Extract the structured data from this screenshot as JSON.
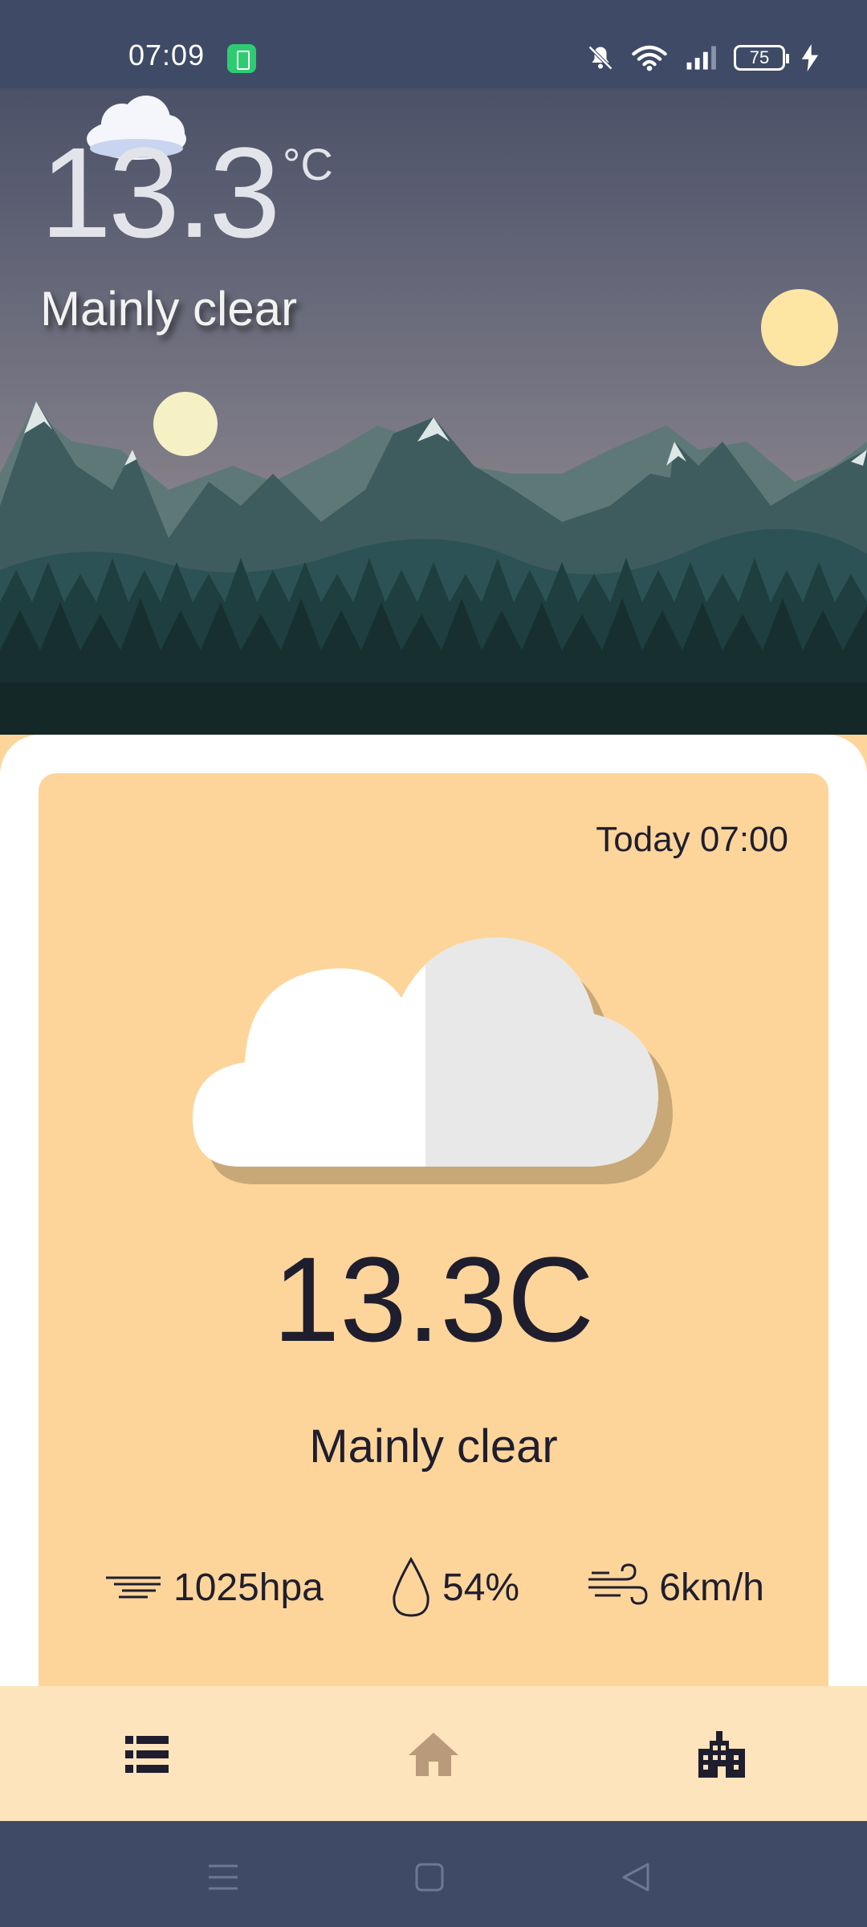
{
  "status_bar": {
    "time": "07:09",
    "battery_level": "75",
    "icons": [
      "battery-saver-icon",
      "mute-bell-icon",
      "wifi-icon",
      "signal-icon",
      "battery-icon",
      "charging-bolt-icon"
    ]
  },
  "hero": {
    "temperature": "13.3",
    "unit": "°C",
    "condition": "Mainly clear"
  },
  "forecast_card": {
    "time": "Today 07:00",
    "temperature": "13.3C",
    "condition": "Mainly clear",
    "pressure": "1025hpa",
    "humidity": "54%",
    "wind": "6km/h"
  },
  "bottom_nav": {
    "items": [
      {
        "icon": "list-icon"
      },
      {
        "icon": "home-icon"
      },
      {
        "icon": "city-icon"
      }
    ]
  },
  "colors": {
    "status_bar": "#3f4a66",
    "card": "#fdd59b",
    "nav": "#fde4bc",
    "text_dark": "#1f1e2e"
  }
}
